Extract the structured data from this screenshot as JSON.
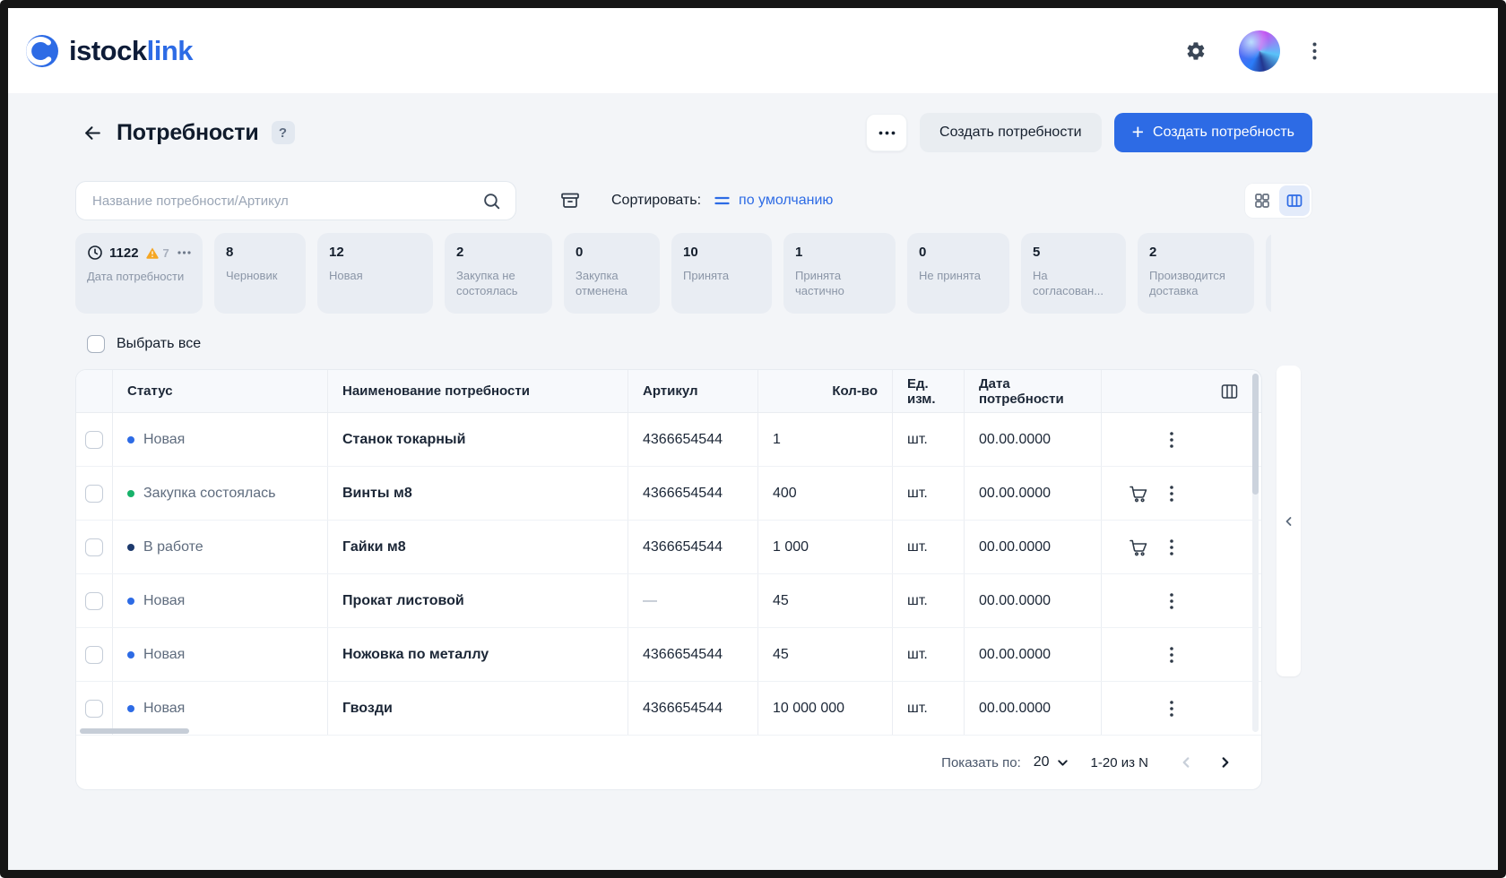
{
  "brand": {
    "word_dark": "istock",
    "word_blue": "link"
  },
  "page": {
    "title": "Потребности",
    "help_badge": "?"
  },
  "actions": {
    "create_secondary": "Создать потребности",
    "create_primary_plus": "+",
    "create_primary": "Создать потребность"
  },
  "toolbar": {
    "search_placeholder": "Название потребности/Артикул",
    "sort_label": "Сортировать:",
    "sort_value": "по умолчанию"
  },
  "filter_chips": [
    {
      "count": "1122",
      "warning_count": "7",
      "label": "Дата потребности"
    },
    {
      "count": "8",
      "label": "Черновик"
    },
    {
      "count": "12",
      "label": "Новая"
    },
    {
      "count": "2",
      "label": "Закупка не состоялась"
    },
    {
      "count": "0",
      "label": "Закупка отменена"
    },
    {
      "count": "10",
      "label": "Принята"
    },
    {
      "count": "1",
      "label": "Принята частично"
    },
    {
      "count": "0",
      "label": "Не принята"
    },
    {
      "count": "5",
      "label": "На согласован..."
    },
    {
      "count": "2",
      "label": "Производится доставка"
    }
  ],
  "select_all_label": "Выбрать все",
  "table": {
    "headers": {
      "status": "Статус",
      "name": "Наименование потребности",
      "sku": "Артикул",
      "qty": "Кол-во",
      "unit": "Ед. изм.",
      "date": "Дата потребности"
    },
    "rows": [
      {
        "status": "Новая",
        "dot": "#2d6be5",
        "name": "Станок токарный",
        "sku": "4366654544",
        "qty": "1",
        "unit": "шт.",
        "date": "00.00.0000"
      },
      {
        "status": "Закупка состоялась",
        "dot": "#17b26a",
        "name": "Винты м8",
        "sku": "4366654544",
        "qty": "400",
        "unit": "шт.",
        "date": "00.00.0000"
      },
      {
        "status": "В работе",
        "dot": "#1d3a6d",
        "name": "Гайки м8",
        "sku": "4366654544",
        "qty": "1 000",
        "unit": "шт.",
        "date": "00.00.0000"
      },
      {
        "status": "Новая",
        "dot": "#2d6be5",
        "name": "Прокат листовой",
        "sku": "—",
        "qty": "45",
        "unit": "шт.",
        "date": "00.00.0000"
      },
      {
        "status": "Новая",
        "dot": "#2d6be5",
        "name": "Ножовка по металлу",
        "sku": "4366654544",
        "qty": "45",
        "unit": "шт.",
        "date": "00.00.0000"
      },
      {
        "status": "Новая",
        "dot": "#2d6be5",
        "name": "Гвозди",
        "sku": "4366654544",
        "qty": "10 000 000",
        "unit": "шт.",
        "date": "00.00.0000"
      }
    ]
  },
  "pagination": {
    "page_size_label": "Показать по:",
    "page_size": "20",
    "range": "1-20 из N"
  },
  "colors": {
    "accent_blue": "#2d6be5",
    "status_new": "#2d6be5",
    "status_purchase_done": "#17b26a",
    "status_in_progress": "#1d3a6d",
    "warning_amber": "#f5a623",
    "chip_background": "#e9edf3",
    "page_background": "#f3f5f8"
  },
  "icons": [
    "gear-icon",
    "avatar",
    "kebab-vertical-icon",
    "back-arrow-icon",
    "help-icon",
    "kebab-horizontal-icon",
    "plus-icon",
    "search-icon",
    "archive-icon",
    "sort-lines-icon",
    "grid-view-icon",
    "table-view-icon",
    "clock-icon",
    "warning-triangle-icon",
    "columns-icon",
    "cart-icon",
    "chevron-down-icon",
    "chevron-left-icon",
    "chevron-right-icon",
    "collapse-chevron-icon"
  ]
}
